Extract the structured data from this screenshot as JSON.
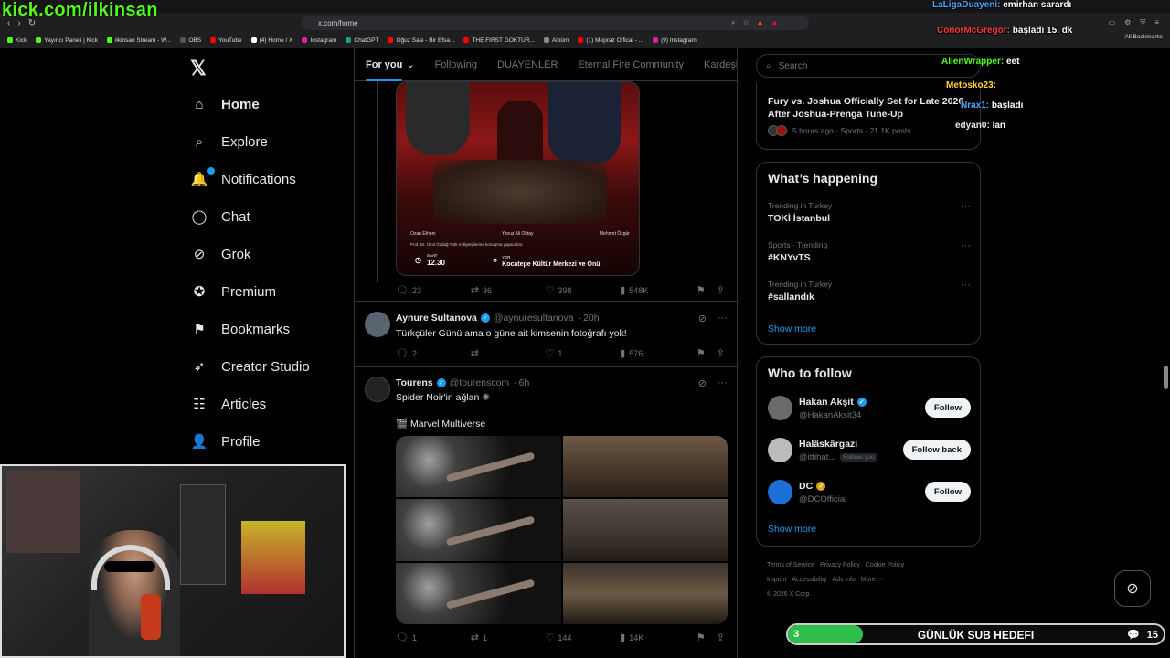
{
  "overlay": {
    "channel_url": "kick.com/ilkinsan",
    "chat": [
      {
        "user": "LaLigaDuayeni:",
        "text": "emirhan sarardı",
        "color": "#4aa8ff"
      },
      {
        "user": "ConorMcGregor:",
        "text": "başladı 15. dk",
        "color": "#ff3b3b"
      },
      {
        "user": "AlienWrapper:",
        "text": "eet",
        "color": "#53fc18"
      },
      {
        "user": "Metosko23:",
        "text": "",
        "color": "#ffd23a"
      },
      {
        "user": "Nrax1:",
        "text": "başladı",
        "color": "#4aa8ff"
      },
      {
        "user": "edyan0:",
        "text": "lan",
        "color": "#e7e9ea"
      }
    ],
    "sub_goal": {
      "current": "3",
      "label": "GÜNLÜK SUB HEDEFI",
      "goal": "15",
      "progress": 0.2
    }
  },
  "browser": {
    "url": "x.com/home",
    "bookmarks": [
      {
        "label": "Kick",
        "color": "#53fc18"
      },
      {
        "label": "Yayıncı Paneli | Kick",
        "color": "#53fc18"
      },
      {
        "label": "ilkinsan Stream - W...",
        "color": "#53fc18"
      },
      {
        "label": "OBS",
        "color": "#555555"
      },
      {
        "label": "YouTube",
        "color": "#ff0000"
      },
      {
        "label": "(4) Home / X",
        "color": "#ffffff"
      },
      {
        "label": "Instagram",
        "color": "#d6249f"
      },
      {
        "label": "ChatGPT",
        "color": "#10a37f"
      },
      {
        "label": "Oğuz Sasi - Bir Efsa...",
        "color": "#ff0000"
      },
      {
        "label": "THE FIRST GOKTUR...",
        "color": "#ff0000"
      },
      {
        "label": "Albüm",
        "color": "#888888"
      },
      {
        "label": "(1) Mepraz Offical - ...",
        "color": "#ff0000"
      },
      {
        "label": "(9) Instagram",
        "color": "#d6249f"
      }
    ],
    "all_bookmarks": "All Bookmarks"
  },
  "nav": {
    "items": [
      {
        "label": "Home",
        "icon": "home-icon"
      },
      {
        "label": "Explore",
        "icon": "search-icon"
      },
      {
        "label": "Notifications",
        "icon": "bell-icon"
      },
      {
        "label": "Chat",
        "icon": "chat-icon"
      },
      {
        "label": "Grok",
        "icon": "grok-icon"
      },
      {
        "label": "Premium",
        "icon": "premium-icon"
      },
      {
        "label": "Bookmarks",
        "icon": "bookmark-icon"
      },
      {
        "label": "Creator Studio",
        "icon": "rocket-icon"
      },
      {
        "label": "Articles",
        "icon": "article-icon"
      },
      {
        "label": "Profile",
        "icon": "person-icon"
      }
    ]
  },
  "tabs": [
    "For you",
    "Following",
    "DUAYENLER",
    "Eternal Fire Community",
    "Kardeşle"
  ],
  "poster": {
    "names": [
      "Ozan Etheni",
      "Yavuz Ali Oktay",
      "Mehmet Özgür"
    ],
    "note": "Prof. Dr. Ümit Özdağ Türk milliyetçilerine konuşma yapacaktır.",
    "time_label": "SAAT",
    "time": "12.30",
    "place_label": "YER",
    "place": "Kocatepe Kültür Merkezi ve Önü"
  },
  "tweet1_actions": {
    "replies": "23",
    "reposts": "36",
    "likes": "398",
    "views": "548K"
  },
  "tweet2": {
    "name": "Aynure Sultanova",
    "handle": "@aynuresultanova",
    "time": "· 20h",
    "text": "Türkçüler Günü ama o güne ait kimsenin fotoğrafı yok!",
    "actions": {
      "replies": "2",
      "reposts": "",
      "likes": "1",
      "views": "576"
    }
  },
  "tweet3": {
    "name": "Tourens",
    "handle": "@tourenscom",
    "time": "· 6h",
    "line1": "Spider Noir'in ağlan",
    "line2": "Marvel Multiverse",
    "actions": {
      "replies": "1",
      "reposts": "1",
      "likes": "144",
      "views": "14K"
    }
  },
  "right": {
    "search_placeholder": "Search",
    "news": {
      "title": "Fury vs. Joshua Officially Set for Late 2026 After Joshua-Prenga Tune-Up",
      "meta": "5 hours ago · Sports · 21.1K posts"
    },
    "happening_title": "What’s happening",
    "trends": [
      {
        "context": "Trending in Turkey",
        "title": "TOKİ İstanbul"
      },
      {
        "context": "Sports · Trending",
        "title": "#KNYvTS"
      },
      {
        "context": "Trending in Turkey",
        "title": "#sallandık"
      }
    ],
    "show_more": "Show more",
    "wtf_title": "Who to follow",
    "follows": [
      {
        "name": "Hakan Akşit",
        "handle": "@HakanAksit34",
        "button": "Follow",
        "badge": "",
        "verified": "blue"
      },
      {
        "name": "Haläskârgazi",
        "handle": "@ittihat...",
        "button": "Follow back",
        "badge": "Follows you",
        "verified": ""
      },
      {
        "name": "DC",
        "handle": "@DCOfficial",
        "button": "Follow",
        "badge": "",
        "verified": "gold"
      }
    ],
    "footer": [
      "Terms of Service",
      "Privacy Policy",
      "Cookie Policy",
      "Imprint",
      "Accessibility",
      "Ads info",
      "More ···",
      "© 2026 X Corp."
    ]
  }
}
